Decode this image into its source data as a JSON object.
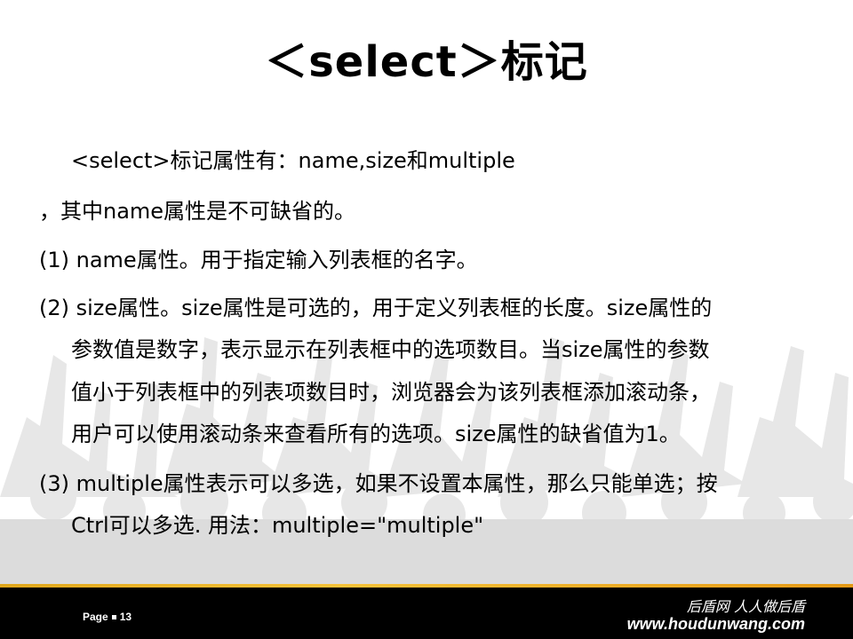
{
  "slide": {
    "title": "＜select＞标记",
    "lines": [
      "<select>标记属性有：name,size和multiple",
      "，其中name属性是不可缺省的。",
      "(1) name属性。用于指定输入列表框的名字。",
      "(2) size属性。size属性是可选的，用于定义列表框的长度。size属性的",
      "参数值是数字，表示显示在列表框中的选项数目。当size属性的参数",
      "值小于列表框中的列表项数目时，浏览器会为该列表框添加滚动条，",
      "用户可以使用滚动条来查看所有的选项。size属性的缺省值为1。",
      "(3) multiple属性表示可以多选，如果不设置本属性，那么只能单选；按",
      "Ctrl可以多选. 用法：multiple=\"multiple\""
    ]
  },
  "footer": {
    "page_label": "Page",
    "page_number": "13",
    "brand_cn": "后盾网 人人做后盾",
    "brand_url": "www.houdunwang.com"
  },
  "colors": {
    "footer_bar": "#000000",
    "footer_accent": "#f7c33a",
    "background_silhouette": "#e6e6e6"
  }
}
